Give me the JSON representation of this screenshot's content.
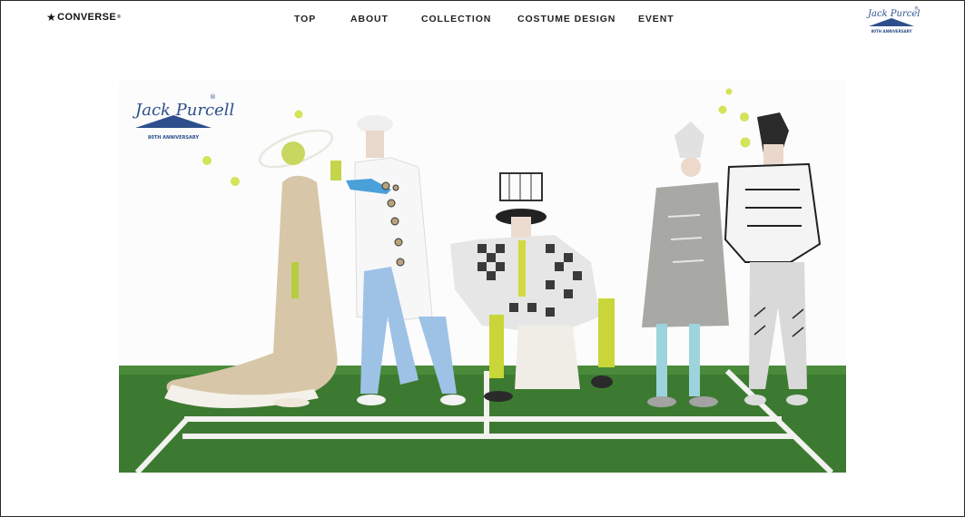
{
  "brand": {
    "logo_text": "CONVERSE",
    "logo_mark": "★",
    "trademark": "®"
  },
  "nav": {
    "items": [
      "TOP",
      "ABOUT",
      "COLLECTION",
      "COSTUME DESIGN",
      "EVENT"
    ]
  },
  "badge": {
    "script": "Jack Purcell",
    "registered": "®",
    "anniversary": "80TH ANNIVERSARY"
  },
  "hero": {
    "logo_script": "Jack Purcell",
    "logo_registered": "®",
    "logo_anniversary": "80TH ANNIVERSARY"
  },
  "colors": {
    "brand_blue": "#2e4f8c",
    "turf": "#3f7a33",
    "court_line": "#f2f2ef",
    "tennis_ball": "#d3e35a"
  }
}
